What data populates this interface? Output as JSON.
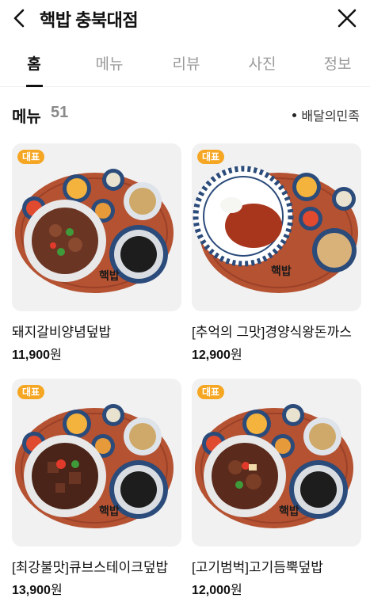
{
  "header": {
    "title": "핵밥 충북대점"
  },
  "tabs": [
    {
      "label": "홈",
      "active": true
    },
    {
      "label": "메뉴",
      "active": false
    },
    {
      "label": "리뷰",
      "active": false
    },
    {
      "label": "사진",
      "active": false
    },
    {
      "label": "정보",
      "active": false
    }
  ],
  "section": {
    "title": "메뉴",
    "count": "51",
    "source": "배달의민족"
  },
  "menu_items": [
    {
      "badge": "대표",
      "name": "돼지갈비양념덮밥",
      "price": "11,900",
      "currency": "원",
      "tray_label": "핵밥"
    },
    {
      "badge": "대표",
      "name": "[추억의 그맛]경양식왕돈까스",
      "price": "12,900",
      "currency": "원",
      "tray_label": "핵밥"
    },
    {
      "badge": "대표",
      "name": "[최강불맛]큐브스테이크덮밥",
      "price": "13,900",
      "currency": "원",
      "tray_label": "핵밥"
    },
    {
      "badge": "대표",
      "name": "[고기범벅]고기듬뿍덮밥",
      "price": "12,000",
      "currency": "원",
      "tray_label": "핵밥"
    }
  ],
  "colors": {
    "badge": "#f5a623",
    "tray": "#b55232",
    "active_tab": "#111111",
    "inactive_tab": "#9a9a9a"
  }
}
